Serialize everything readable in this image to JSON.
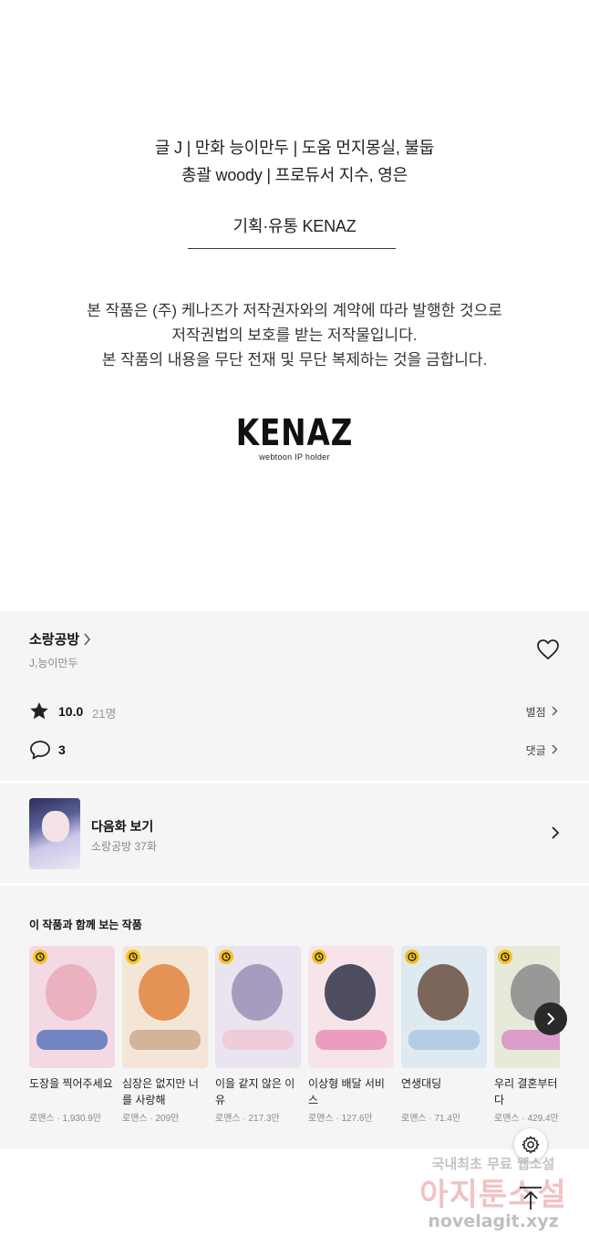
{
  "credits": {
    "line1": "글 J | 만화 능이만두 | 도움 먼지몽실, 불둡",
    "line2": "총괄 woody | 프로듀서 지수, 영은",
    "distribution": "기획·유통 KENAZ",
    "notice1": "본 작품은 (주) 케나즈가 저작권자와의 계약에 따라 발행한 것으로",
    "notice2": "저작권법의 보호를 받는 저작물입니다.",
    "notice3": "본 작품의 내용을 무단 전재 및 무단 복제하는 것을 금합니다.",
    "logo_text": "KENAZ",
    "logo_sub": "webtoon IP holder"
  },
  "series": {
    "title": "소랑공방",
    "authors": "J,능이만두",
    "rating": "10.0",
    "rating_count": "21명",
    "rating_link": "별점",
    "comment_count": "3",
    "comment_link": "댓글"
  },
  "next_episode": {
    "label": "다음화 보기",
    "subtitle": "소랑공방 37화"
  },
  "recommendations": {
    "heading": "이 작품과 함께 보는 작품",
    "items": [
      {
        "title": "도장을 찍어주세요",
        "meta": "로맨스 · 1,930.9만",
        "cover": "#f3d9e4",
        "c1": "#e9a9b8",
        "c2": "#4f6fb8"
      },
      {
        "title": "심장은 없지만 너를 사랑해",
        "meta": "로맨스 · 209만",
        "cover": "#f4e6d6",
        "c1": "#e0833f",
        "c2": "#c9a88a"
      },
      {
        "title": "이을 같지 않은 이유",
        "meta": "로맨스 · 217.3만",
        "cover": "#e9e4ef",
        "c1": "#9c8fb5",
        "c2": "#f0c6d6"
      },
      {
        "title": "이상형 배달 서비스",
        "meta": "로맨스 · 127.6만",
        "cover": "#f7e4ea",
        "c1": "#2f3246",
        "c2": "#e88bb4"
      },
      {
        "title": "연생대딩",
        "meta": "로맨스 · 71.4만",
        "cover": "#dfe9f2",
        "c1": "#6a4f40",
        "c2": "#a9c6e0"
      },
      {
        "title": "우리 결혼부터 시다",
        "meta": "로맨스 · 429.4만",
        "cover": "#e6ead9",
        "c1": "#8a8a8a",
        "c2": "#d98ac6"
      }
    ]
  },
  "watermark": {
    "line1": "국내최초 무료 웹소설",
    "line2": "아지툰소설",
    "line3": "novelagit.xyz"
  }
}
